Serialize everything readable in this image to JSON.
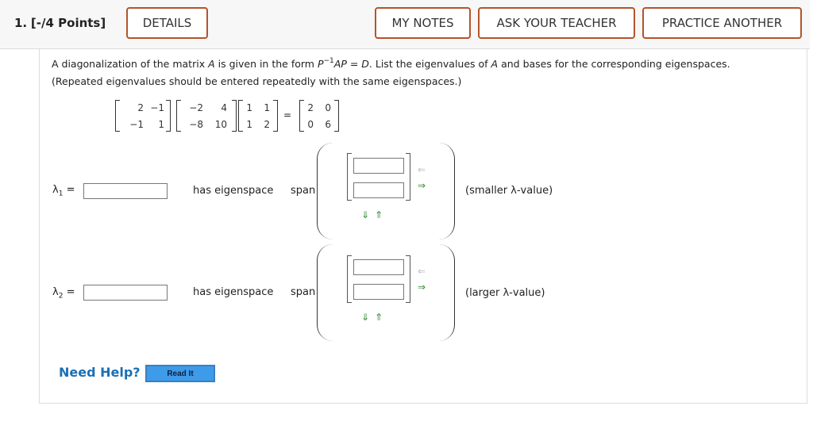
{
  "header": {
    "question_number": "1.",
    "points": "[-/4 Points]",
    "details_label": "DETAILS",
    "my_notes_label": "MY NOTES",
    "ask_teacher_label": "ASK YOUR TEACHER",
    "practice_another_label": "PRACTICE ANOTHER"
  },
  "question": {
    "prompt_part1": "A diagonalization of the matrix ",
    "var_A": "A",
    "prompt_part2": " is given in the form ",
    "var_P": "P",
    "exponent": "−1",
    "var_AP": "AP",
    "eq": " = ",
    "var_D": "D",
    "prompt_part3": ". List the eigenvalues of ",
    "prompt_part4": " and bases for the corresponding eigenspaces. (Repeated eigenvalues should be entered repeatedly with the same eigenspaces.)",
    "equals_sign": "=",
    "matrices": {
      "m1": [
        "2",
        "−1",
        "−1",
        "1"
      ],
      "m2": [
        "−2",
        "4",
        "−8",
        "10"
      ],
      "m3": [
        "1",
        "1",
        "1",
        "2"
      ],
      "m4": [
        "2",
        "0",
        "0",
        "6"
      ]
    }
  },
  "rows": [
    {
      "lambda_symbol": "λ",
      "lambda_sub": "1",
      "equals": "=",
      "has_eigenspace": "has eigenspace",
      "span": "span",
      "note": "(smaller λ-value)"
    },
    {
      "lambda_symbol": "λ",
      "lambda_sub": "2",
      "equals": "=",
      "has_eigenspace": "has eigenspace",
      "span": "span",
      "note": "(larger λ-value)"
    }
  ],
  "arrows": {
    "left": "⇐",
    "right": "⇒",
    "down": "⇓",
    "up": "⇑"
  },
  "help": {
    "need_help": "Need Help?",
    "read_it": "Read It"
  },
  "colors": {
    "button_border": "#b5532a",
    "link_blue": "#1a6fb5",
    "read_it_bg": "#3d9be9",
    "arrow_green": "#2f8a2f",
    "arrow_gray": "#bbbbbb"
  }
}
